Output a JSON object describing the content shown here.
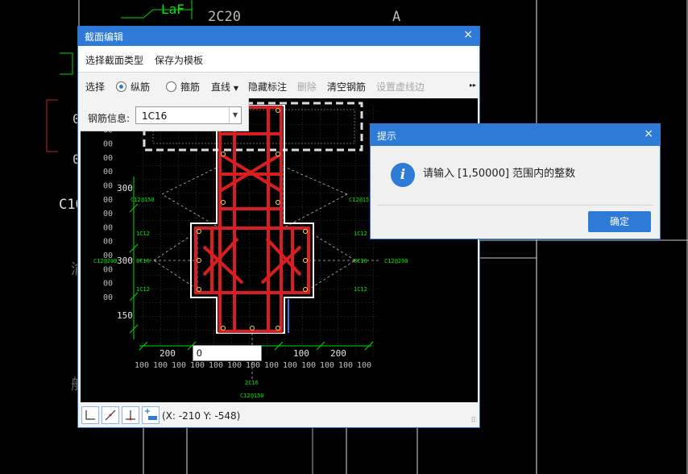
{
  "background": {
    "labels": {
      "laf": "LaF",
      "rebar_2c20": "2C20",
      "axis_a": "A",
      "c10": "C10",
      "zero": "0",
      "zero2": "0",
      "ghost1": "渝",
      "ghost2": "船"
    }
  },
  "panel": {
    "title": "截面编辑",
    "close": "×",
    "menu": {
      "select_section_type": "选择截面类型",
      "save_as_template": "保存为模板"
    },
    "toolbar": {
      "select": "选择",
      "longitudinal": "纵筋",
      "stirrup": "箍筋",
      "line_mode": "直线",
      "hide_label": "隐藏标注",
      "delete": "删除",
      "clear_rebar": "清空钢筋",
      "set_dashed": "设置虚线边",
      "more": "▸▸"
    },
    "rebar_info": {
      "label": "钢筋信息:",
      "value": "1C16"
    },
    "coord_input_value": "0",
    "status": {
      "coords": "(X: -210 Y: -548)"
    }
  },
  "drawing": {
    "left_dims": [
      "00",
      "00",
      "00",
      "00",
      "00",
      "00",
      "00",
      "00",
      "00",
      "00",
      "00",
      "00",
      "00",
      "00"
    ],
    "dim_300a": "300",
    "dim_300b": "300",
    "dim_150": "150",
    "bottom_dim_200a": "200",
    "bottom_dim_100": "100",
    "bottom_dim_200b": "200",
    "bottom_ticks": [
      "100",
      "100",
      "100",
      "100",
      "100",
      "100",
      "100",
      "100",
      "100",
      "100",
      "100",
      "100",
      "100"
    ],
    "label_c12_150_left": "C12@150",
    "label_c12_150_right": "C12@15",
    "label_c12_200_left": "C12@200",
    "label_c12_200_right": "C12@200",
    "label_1c12_a": "1C12",
    "label_1c12_b": "1C12",
    "label_1c12_c": "1C12",
    "label_1c12_d": "1C12",
    "label_8c16_left": "8C16",
    "label_8c16_right": "8C16",
    "label_2c16": "2C16",
    "label_c12_150_bottom": "C12@150",
    "colors": {
      "rebar": "#d81e1e",
      "label": "#00ee00",
      "outline": "#ffffff",
      "dashed": "#cfcfcf"
    }
  },
  "dialog": {
    "title": "提示",
    "close": "×",
    "icon": "info-icon",
    "message": "请输入 [1,50000] 范围内的整数",
    "ok": "确定"
  }
}
